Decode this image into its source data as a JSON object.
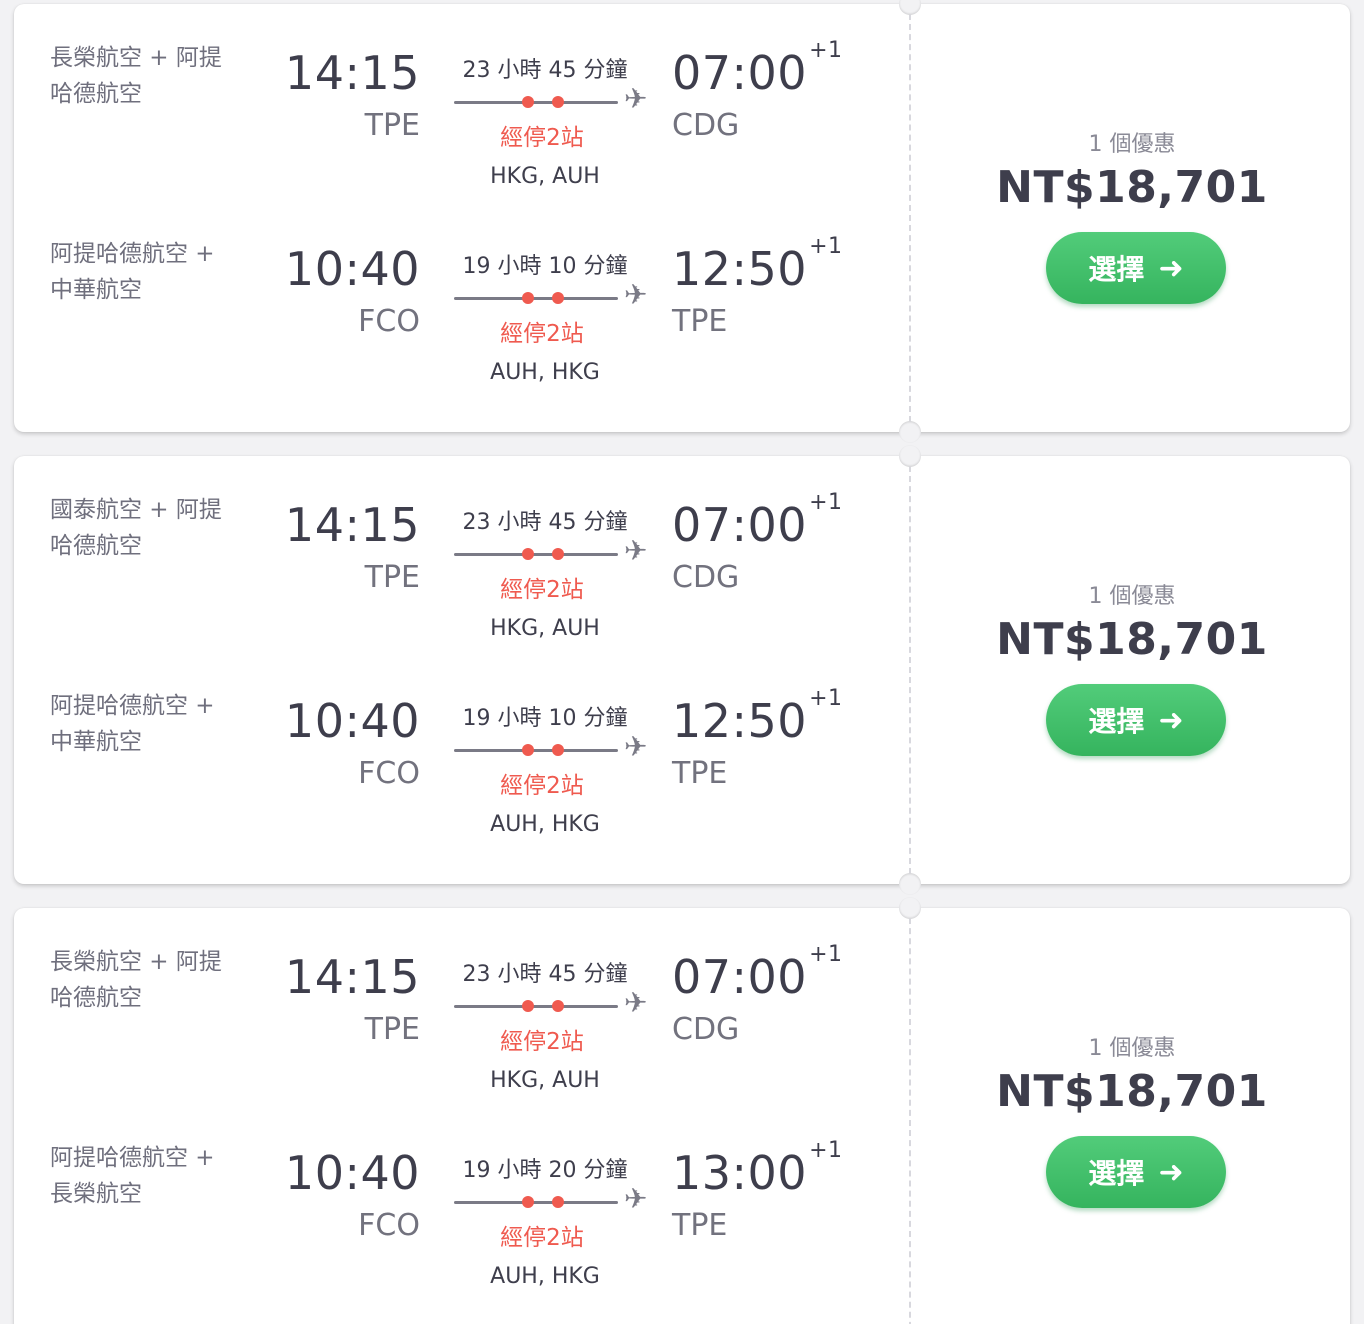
{
  "results": [
    {
      "legs": [
        {
          "airline": "長榮航空 + 阿提哈德航空",
          "dep_time": "14:15",
          "dep_code": "TPE",
          "duration": "23 小時 45 分鐘",
          "stops": "經停2站",
          "via": "HKG, AUH",
          "arr_time": "07:00",
          "arr_offset": "+1",
          "arr_code": "CDG"
        },
        {
          "airline": "阿提哈德航空 + 中華航空",
          "dep_time": "10:40",
          "dep_code": "FCO",
          "duration": "19 小時 10 分鐘",
          "stops": "經停2站",
          "via": "AUH, HKG",
          "arr_time": "12:50",
          "arr_offset": "+1",
          "arr_code": "TPE"
        }
      ],
      "deals": "1 個優惠",
      "price": "NT$18,701",
      "select_label": "選擇"
    },
    {
      "legs": [
        {
          "airline": "國泰航空 + 阿提哈德航空",
          "dep_time": "14:15",
          "dep_code": "TPE",
          "duration": "23 小時 45 分鐘",
          "stops": "經停2站",
          "via": "HKG, AUH",
          "arr_time": "07:00",
          "arr_offset": "+1",
          "arr_code": "CDG"
        },
        {
          "airline": "阿提哈德航空 + 中華航空",
          "dep_time": "10:40",
          "dep_code": "FCO",
          "duration": "19 小時 10 分鐘",
          "stops": "經停2站",
          "via": "AUH, HKG",
          "arr_time": "12:50",
          "arr_offset": "+1",
          "arr_code": "TPE"
        }
      ],
      "deals": "1 個優惠",
      "price": "NT$18,701",
      "select_label": "選擇"
    },
    {
      "legs": [
        {
          "airline": "長榮航空 + 阿提哈德航空",
          "dep_time": "14:15",
          "dep_code": "TPE",
          "duration": "23 小時 45 分鐘",
          "stops": "經停2站",
          "via": "HKG, AUH",
          "arr_time": "07:00",
          "arr_offset": "+1",
          "arr_code": "CDG"
        },
        {
          "airline": "阿提哈德航空 + 長榮航空",
          "dep_time": "10:40",
          "dep_code": "FCO",
          "duration": "19 小時 20 分鐘",
          "stops": "經停2站",
          "via": "AUH, HKG",
          "arr_time": "13:00",
          "arr_offset": "+1",
          "arr_code": "TPE"
        }
      ],
      "deals": "1 個優惠",
      "price": "NT$18,701",
      "select_label": "選擇"
    }
  ],
  "icons": {
    "route_end": "plane-icon",
    "button_arrow": "arrow-right-icon"
  },
  "colors": {
    "accent_green": "#3dbd68",
    "stops_red": "#ef5a4f",
    "text_dark": "#3e3e4c"
  }
}
